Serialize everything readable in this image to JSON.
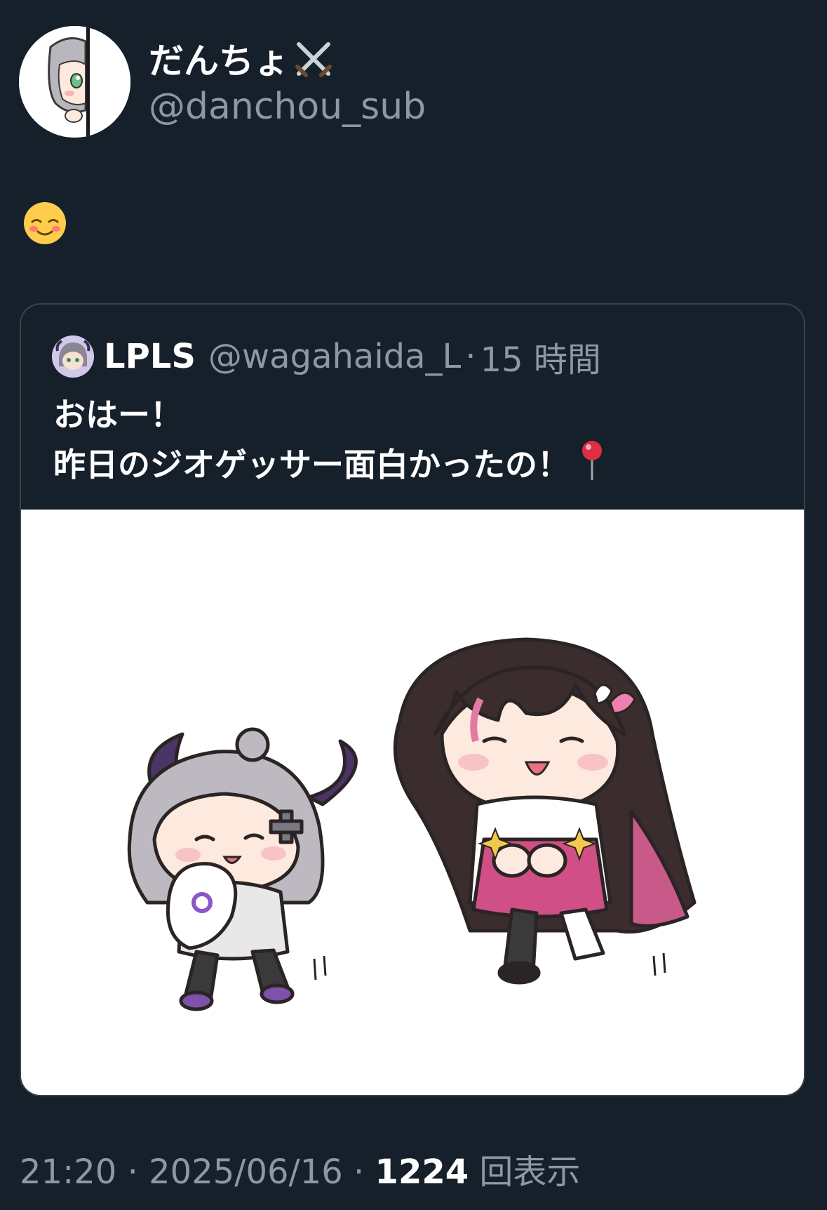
{
  "tweet": {
    "author": {
      "display_name": "だんちょ",
      "name_emoji": "crossed-swords-icon",
      "handle": "@danchou_sub",
      "avatar": "avatar-chibi-girl"
    },
    "body_emoji": "smiling-face-icon",
    "quote": {
      "author": {
        "display_name": "LPLS",
        "handle": "@wagahaida_L",
        "separator": "·",
        "time": "15 時間",
        "avatar": "avatar-chibi-silver-hair"
      },
      "lines": [
        "おはー！",
        "昨日のジオゲッサー面白かったの！"
      ],
      "line_emoji": "round-pushpin-icon",
      "image": "illustration-two-chibi-characters"
    },
    "meta": {
      "time": "21:20",
      "sep1": " · ",
      "date": "2025/06/16",
      "sep2": " · ",
      "views_count": "1224",
      "views_label": " 回表示"
    }
  },
  "colors": {
    "background": "#15202b",
    "secondary_text": "#8b98a5",
    "border": "#38444d",
    "primary_text": "#ffffff"
  }
}
